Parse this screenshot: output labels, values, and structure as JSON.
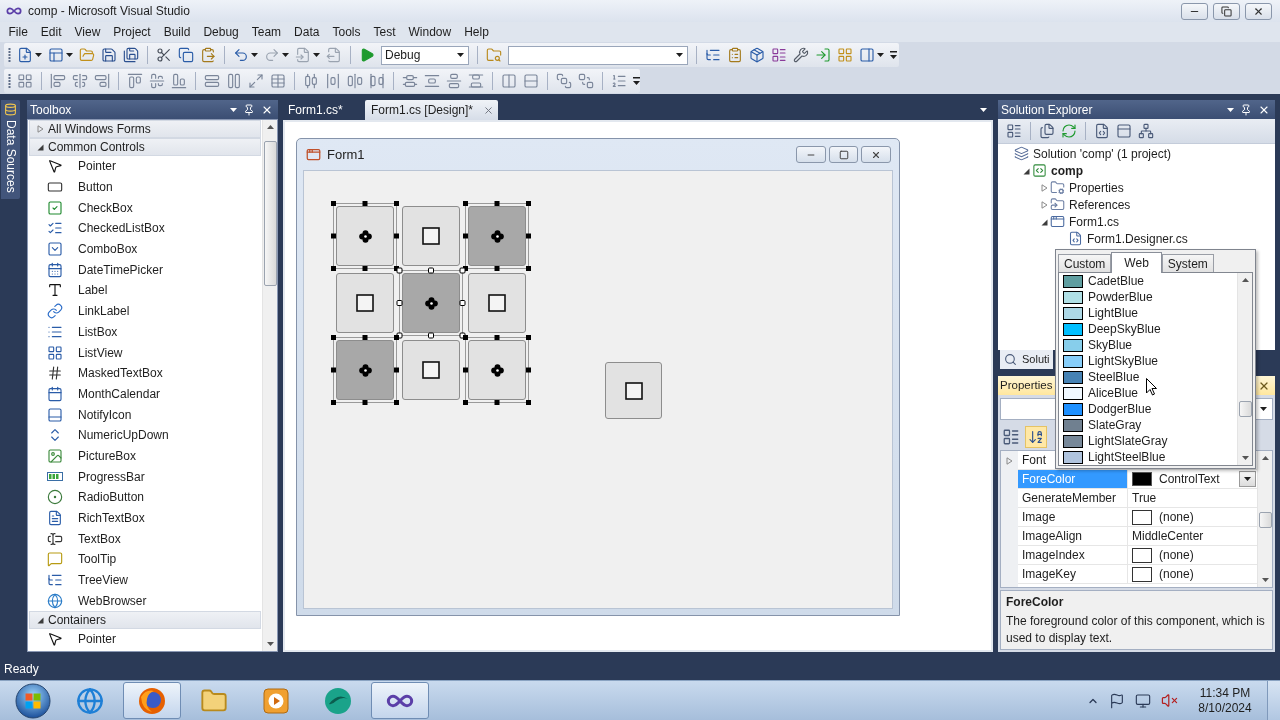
{
  "window": {
    "title": "comp - Microsoft Visual Studio"
  },
  "menu": [
    "File",
    "Edit",
    "View",
    "Project",
    "Build",
    "Debug",
    "Team",
    "Data",
    "Tools",
    "Test",
    "Window",
    "Help"
  ],
  "toolbar": {
    "configuration": "Debug"
  },
  "side_tabs": [
    "Data Sources"
  ],
  "toolbox": {
    "title": "Toolbox",
    "groups": [
      {
        "label": "All Windows Forms",
        "expanded": false
      },
      {
        "label": "Common Controls",
        "expanded": true,
        "items": [
          "Pointer",
          "Button",
          "CheckBox",
          "CheckedListBox",
          "ComboBox",
          "DateTimePicker",
          "Label",
          "LinkLabel",
          "ListBox",
          "ListView",
          "MaskedTextBox",
          "MonthCalendar",
          "NotifyIcon",
          "NumericUpDown",
          "PictureBox",
          "ProgressBar",
          "RadioButton",
          "RichTextBox",
          "TextBox",
          "ToolTip",
          "TreeView",
          "WebBrowser"
        ]
      },
      {
        "label": "Containers",
        "expanded": true,
        "items": [
          "Pointer"
        ]
      }
    ]
  },
  "document_tabs": [
    {
      "label": "Form1.cs*",
      "selected": false
    },
    {
      "label": "Form1.cs [Design]*",
      "selected": true
    }
  ],
  "form": {
    "title": "Form1",
    "grid_buttons": [
      {
        "kind": "flower",
        "color": "#e2e2e2",
        "selected": true,
        "primary": false
      },
      {
        "kind": "square",
        "color": "#e2e2e2",
        "selected": false
      },
      {
        "kind": "flower",
        "color": "#a8a8a8",
        "selected": true,
        "primary": false
      },
      {
        "kind": "square",
        "color": "#e2e2e2",
        "selected": false
      },
      {
        "kind": "flower",
        "color": "#a8a8a8",
        "selected": true,
        "primary": true
      },
      {
        "kind": "square",
        "color": "#e2e2e2",
        "selected": false
      },
      {
        "kind": "flower",
        "color": "#a8a8a8",
        "selected": true,
        "primary": false
      },
      {
        "kind": "square",
        "color": "#e2e2e2",
        "selected": false
      },
      {
        "kind": "flower",
        "color": "#e2e2e2",
        "selected": true,
        "primary": false
      }
    ],
    "lone_button": {
      "kind": "square",
      "color": "#e2e2e2",
      "selected": false
    }
  },
  "solution_explorer": {
    "title": "Solution Explorer",
    "tree": [
      {
        "label": "Solution 'comp' (1 project)",
        "kind": "solution",
        "children": [
          {
            "label": "comp",
            "kind": "project",
            "expanded": true,
            "children": [
              {
                "label": "Properties",
                "kind": "properties",
                "expanded": false
              },
              {
                "label": "References",
                "kind": "references",
                "expanded": false
              },
              {
                "label": "Form1.cs",
                "kind": "form",
                "expanded": true,
                "children": [
                  {
                    "label": "Form1.Designer.cs",
                    "kind": "code"
                  }
                ]
              }
            ]
          }
        ]
      }
    ],
    "tabs": [
      "Soluti"
    ]
  },
  "properties": {
    "title": "Properties",
    "rows": [
      {
        "name": "Font",
        "kind": "group",
        "expanded": false,
        "selected": false
      },
      {
        "name": "ForeColor",
        "kind": "color",
        "value": "ControlText",
        "color": "#000000",
        "selected": true
      },
      {
        "name": "GenerateMember",
        "kind": "text",
        "value": "True",
        "selected": false
      },
      {
        "name": "Image",
        "kind": "image",
        "value": "(none)",
        "selected": false
      },
      {
        "name": "ImageAlign",
        "kind": "text",
        "value": "MiddleCenter",
        "selected": false
      },
      {
        "name": "ImageIndex",
        "kind": "image",
        "value": "(none)",
        "selected": false
      },
      {
        "name": "ImageKey",
        "kind": "image",
        "value": "(none)",
        "selected": false
      }
    ],
    "description": {
      "title": "ForeColor",
      "text": "The foreground color of this component, which is used to display text."
    }
  },
  "color_picker": {
    "tabs": [
      {
        "label": "Custom",
        "selected": false
      },
      {
        "label": "Web",
        "selected": true
      },
      {
        "label": "System",
        "selected": false
      }
    ],
    "colors": [
      {
        "name": "CadetBlue",
        "color": "#5f9ea0"
      },
      {
        "name": "PowderBlue",
        "color": "#b0e0e6"
      },
      {
        "name": "LightBlue",
        "color": "#add8e6"
      },
      {
        "name": "DeepSkyBlue",
        "color": "#00bfff"
      },
      {
        "name": "SkyBlue",
        "color": "#87ceeb"
      },
      {
        "name": "LightSkyBlue",
        "color": "#87cefa"
      },
      {
        "name": "SteelBlue",
        "color": "#4682b4"
      },
      {
        "name": "AliceBlue",
        "color": "#f0f8ff"
      },
      {
        "name": "DodgerBlue",
        "color": "#1e90ff"
      },
      {
        "name": "SlateGray",
        "color": "#708090"
      },
      {
        "name": "LightSlateGray",
        "color": "#778899"
      },
      {
        "name": "LightSteelBlue",
        "color": "#b0c4de"
      }
    ]
  },
  "status_bar": {
    "text": "Ready"
  },
  "taskbar": {
    "apps": [
      {
        "active": false
      },
      {
        "active": true
      },
      {
        "active": false
      },
      {
        "active": false
      },
      {
        "active": false
      },
      {
        "active": true
      }
    ],
    "time": "11:34 PM",
    "date": "8/10/2024"
  }
}
